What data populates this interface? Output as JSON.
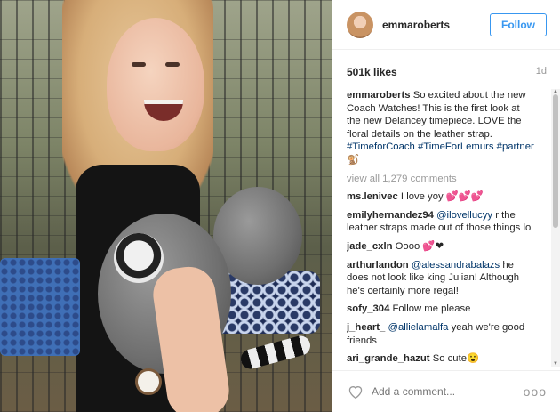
{
  "post": {
    "username": "emmaroberts",
    "follow_label": "Follow",
    "likes": "501k likes",
    "age": "1d"
  },
  "caption": {
    "username": "emmaroberts",
    "text": "So excited about the new Coach Watches! This is the first look at the new Delancey timepiece. LOVE the floral details on the leather strap.",
    "hashtags": "#TimeforCoach #TimeForLemurs #partner",
    "emoji": "🐒"
  },
  "view_all": "view all 1,279 comments",
  "comments": [
    {
      "user": "ms.lenivec",
      "mention": "",
      "text": "I love yoy 💕💕💕"
    },
    {
      "user": "emilyhernandez94",
      "mention": "@ilovellucyy",
      "text": "r the leather straps made out of those things lol"
    },
    {
      "user": "jade_cxln",
      "mention": "",
      "text": "Oooo 💕❤"
    },
    {
      "user": "arthurlandon",
      "mention": "@alessandrabalazs",
      "text": "he does not look like king Julian! Although he's certainly more regal!"
    },
    {
      "user": "sofy_304",
      "mention": "",
      "text": "Follow me please"
    },
    {
      "user": "j_heart_",
      "mention": "@allielamalfa",
      "text": "yeah we're good friends"
    },
    {
      "user": "ari_grande_hazut",
      "mention": "",
      "text": "So cute😮"
    }
  ],
  "footer": {
    "add_comment_placeholder": "Add a comment...",
    "more": "ooo"
  },
  "colors": {
    "accent": "#3897f0",
    "link": "#003569",
    "muted": "#999999"
  },
  "icons": {
    "like": "heart-icon",
    "more": "more-options-icon"
  }
}
